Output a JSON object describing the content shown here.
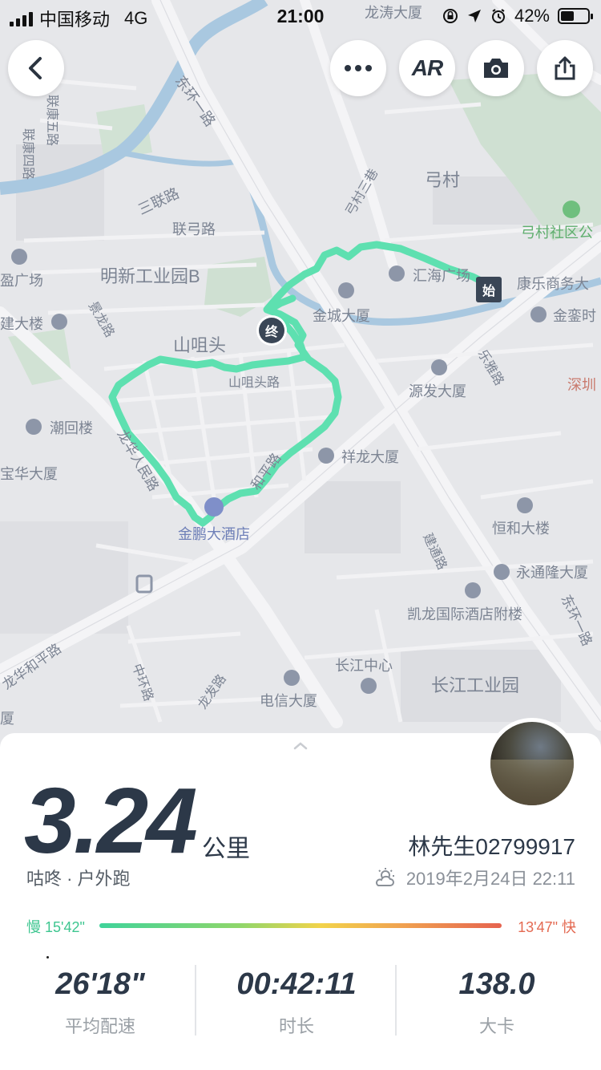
{
  "status_bar": {
    "carrier": "中国移动",
    "network": "4G",
    "time": "21:00",
    "battery": "42%"
  },
  "map": {
    "labels": {
      "longtao": "龙涛大厦",
      "dongyi_1": "东环一路",
      "lianhe5": "联康五路",
      "lianyi4": "联康四路",
      "sanlian": "三联路",
      "liangong": "联弓路",
      "gongcun": "弓村",
      "gongcun3": "弓村三巷",
      "gongcun_park": "弓村社区公",
      "mingxin": "明新工业园B",
      "yingguang": "盈广场",
      "jianda": "建大楼",
      "jinglong": "景龙路",
      "huihai": "汇海广场",
      "kangle": "康乐商务大",
      "jinxi": "金銮时",
      "jincheng": "金城大厦",
      "shanyantou": "山咀头",
      "shantou_rd": "山咀头路",
      "leya": "乐雅路",
      "yuanfa": "源发大厦",
      "shenzhen": "深圳",
      "chaohui": "潮回楼",
      "huahe": "宝华大厦",
      "longhua": "龙华人民路",
      "xianglong": "祥龙大厦",
      "heping": "和平路",
      "jinpeng": "金鹏大酒店",
      "henghe": "恒和大楼",
      "jiantong": "建通路",
      "yongtonglong": "永通隆大厦",
      "dongyi_2": "东环一路",
      "kailong": "凯龙国际酒店附楼",
      "longhua_heping": "龙华和平路",
      "zhonghuan": "中环路",
      "longfa": "龙发路",
      "changjiang_center": "长江中心",
      "dianxin": "电信大厦",
      "changjiang_park": "长江工业园",
      "xia": "厦"
    },
    "markers": {
      "start": "始",
      "end": "终"
    },
    "colors": {
      "route": "#5ee0b0",
      "marker": "#3a4656"
    }
  },
  "toolbar": {
    "back_icon": "chevron-left-icon",
    "more_icon": "more-icon",
    "ar_label": "AR",
    "camera_icon": "camera-icon",
    "share_icon": "share-icon"
  },
  "summary": {
    "distance": "3.24",
    "unit": "公里",
    "sub_label": "咕咚 · 户外跑",
    "username": "林先生02799917",
    "datetime": "2019年2月24日 22:11",
    "pace_slow": "慢 15'42\"",
    "pace_fast": "13'47\" 快",
    "stats": [
      {
        "value": "26'18\"",
        "label": "平均配速"
      },
      {
        "value": "00:42:11",
        "label": "时长"
      },
      {
        "value": "138.0",
        "label": "大卡"
      }
    ]
  }
}
